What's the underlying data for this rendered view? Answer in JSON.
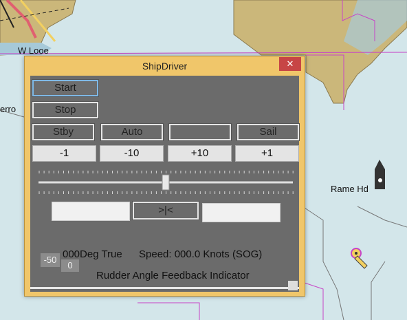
{
  "map": {
    "labels": {
      "w_looe": "W Looe",
      "erro": "erro",
      "rame_hd": "Rame Hd"
    },
    "colors": {
      "sea": "#d3e6ea",
      "land": "#cbb77a",
      "deep": "#a6c9d8",
      "boundary": "#c744c7"
    }
  },
  "window": {
    "title": "ShipDriver",
    "close_label": "✕",
    "buttons": {
      "start": "Start",
      "stop": "Stop",
      "stby": "Stby",
      "auto": "Auto",
      "blank": "",
      "sail": "Sail",
      "minus1": "-1",
      "minus10": "-10",
      "plus10": "+10",
      "plus1": "+1",
      "center": ">|<"
    },
    "slider": {
      "level_fraction": 0.5
    },
    "heading": "000Deg True",
    "speed": "Speed: 000.0 Knots (SOG)",
    "rudder_label": "Rudder Angle Feedback Indicator",
    "rudder_min": "-50",
    "rudder_value": "0",
    "colors": {
      "frame": "#f0c66a",
      "client": "#6b6b6b",
      "close": "#c74545",
      "focus": "#7fb9e6"
    }
  }
}
